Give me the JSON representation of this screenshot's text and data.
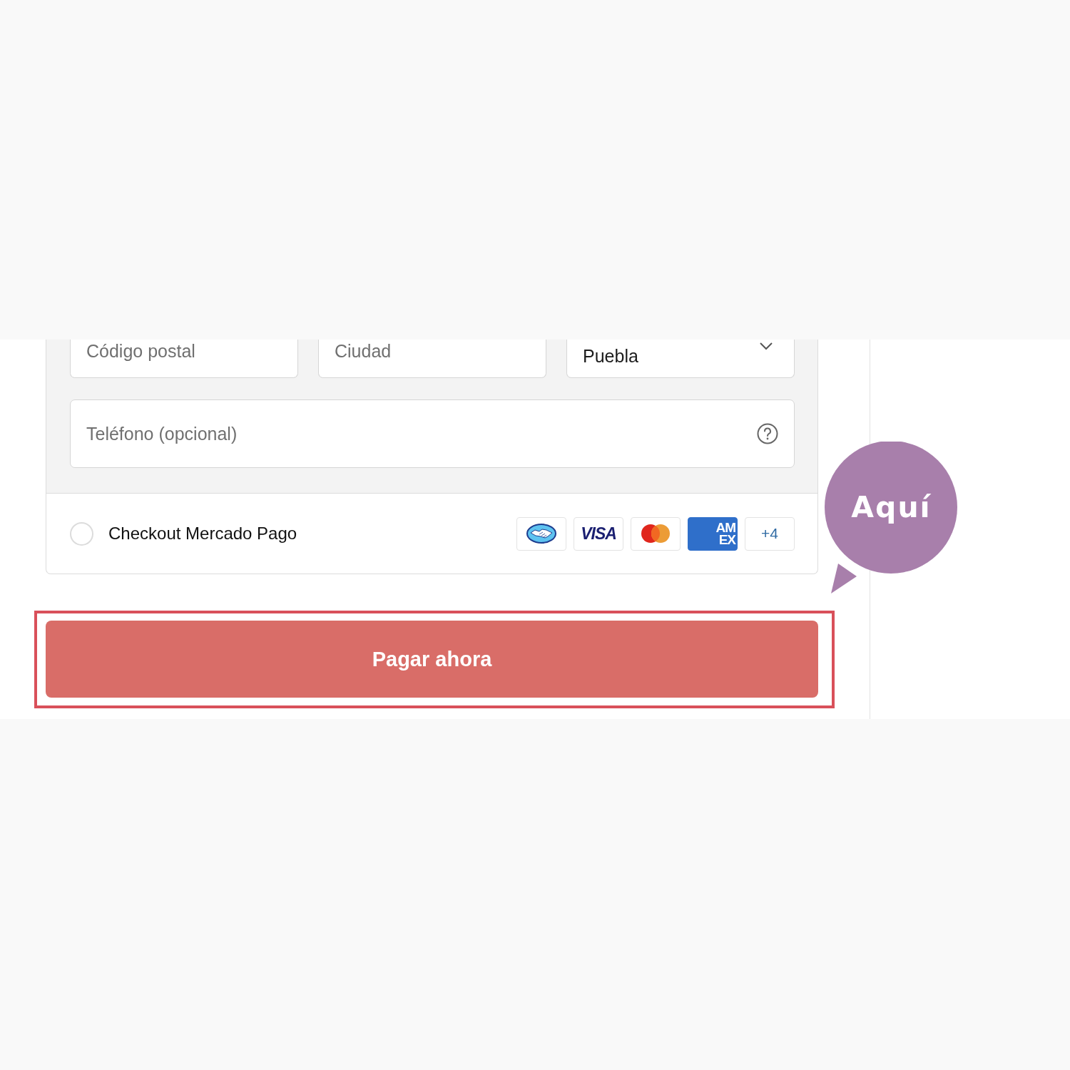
{
  "address_fields": [
    {
      "kind": "input",
      "placeholder": "Código postal"
    },
    {
      "kind": "input",
      "placeholder": "Ciudad"
    },
    {
      "kind": "select",
      "value": "Puebla"
    }
  ],
  "phone_field": {
    "placeholder": "Teléfono (opcional)"
  },
  "payment_option": {
    "label": "Checkout Mercado Pago",
    "selected": false,
    "logos": [
      {
        "kind": "mercadopago"
      },
      {
        "kind": "visa",
        "text": "VISA"
      },
      {
        "kind": "mastercard"
      },
      {
        "kind": "amex",
        "lines": [
          "AM",
          "EX"
        ]
      },
      {
        "kind": "more",
        "text": "+4"
      }
    ]
  },
  "submit_button": {
    "label": "Pagar ahora",
    "highlighted": true
  },
  "callout": {
    "text": "Aquí"
  }
}
